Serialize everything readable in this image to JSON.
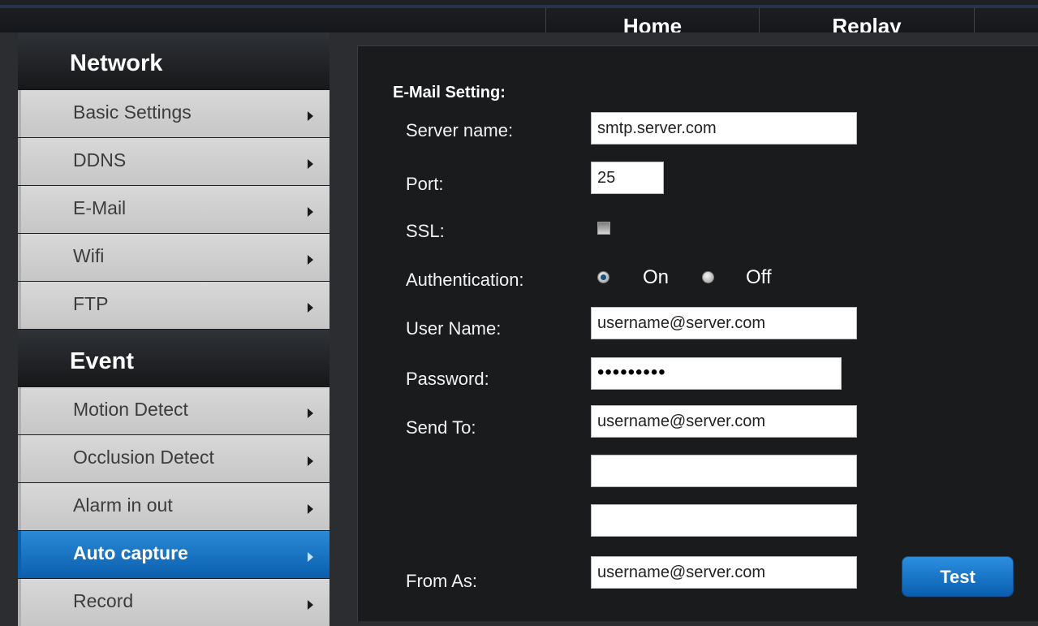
{
  "topnav": {
    "home": "Home",
    "replay": "Replay"
  },
  "sidebar": {
    "network_title": "Network",
    "network_items": [
      "Basic Settings",
      "DDNS",
      "E-Mail",
      "Wifi",
      "FTP"
    ],
    "event_title": "Event",
    "event_items": [
      "Motion Detect",
      "Occlusion Detect",
      "Alarm in out",
      "Auto capture",
      "Record"
    ],
    "active_item": "Auto capture"
  },
  "email": {
    "title": "E-Mail Setting:",
    "server_label": "Server name:",
    "server_value": "smtp.server.com",
    "port_label": "Port:",
    "port_value": "25",
    "ssl_label": "SSL:",
    "ssl_checked": false,
    "auth_label": "Authentication:",
    "auth_on": "On",
    "auth_off": "Off",
    "auth_selected": "On",
    "user_label": "User Name:",
    "user_value": "username@server.com",
    "password_label": "Password:",
    "password_value": "•••••••••",
    "sendto_label": "Send To:",
    "sendto_value": "username@server.com",
    "sendto2_value": "",
    "sendto3_value": "",
    "from_label": "From As:",
    "from_value": "username@server.com",
    "test_button": "Test"
  },
  "colors": {
    "accent": "#0a6fc4",
    "panel_bg": "#1a1b1d",
    "sidebar_item_bg": "#d0d0d0"
  }
}
